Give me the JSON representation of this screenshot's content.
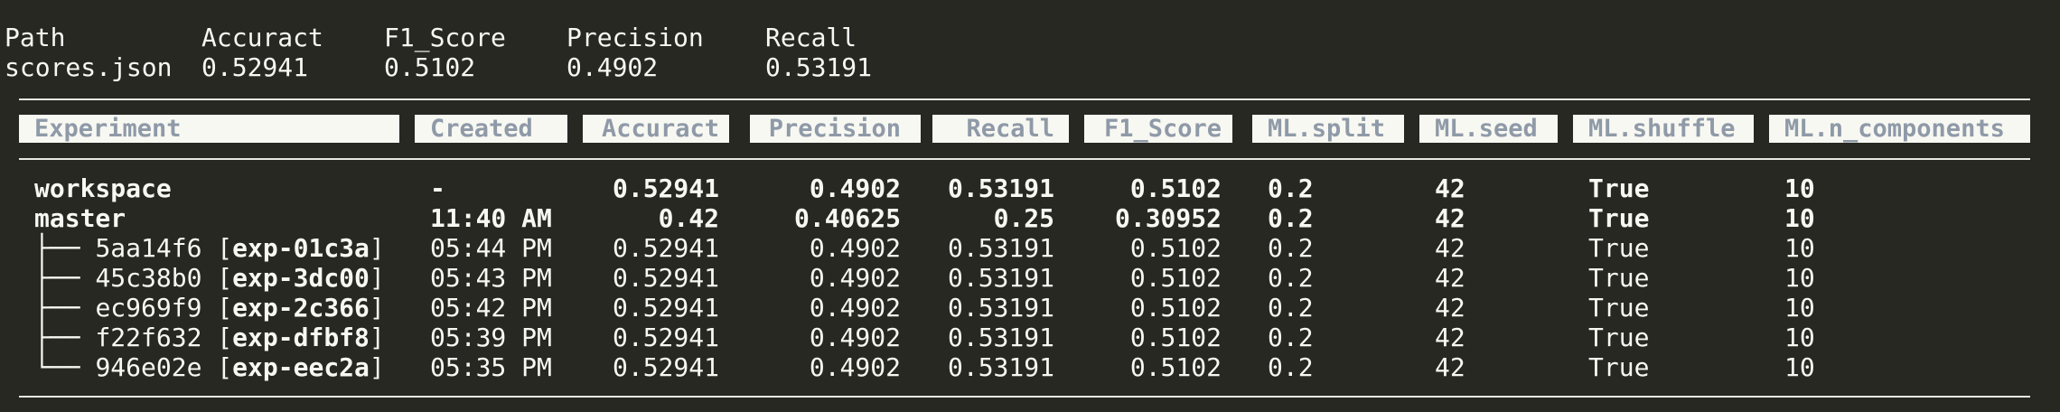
{
  "scores": {
    "headers": [
      "Path",
      "Accuract",
      "F1_Score",
      "Precision",
      "Recall"
    ],
    "values": [
      "scores.json",
      "0.52941",
      "0.5102",
      "0.4902",
      "0.53191"
    ]
  },
  "table": {
    "headers": [
      "Experiment",
      "Created",
      "Accuract",
      "Precision",
      "Recall",
      "F1_Score",
      "ML.split",
      "ML.seed",
      "ML.shuffle",
      "ML.n_components"
    ],
    "rows": [
      {
        "experiment": "workspace",
        "created": "-",
        "accuract": "0.52941",
        "precision": "0.4902",
        "recall": "0.53191",
        "f1_score": "0.5102",
        "split": "0.2",
        "seed": "42",
        "shuffle": "True",
        "n_components": "10"
      },
      {
        "experiment": "master",
        "created": "11:40 AM",
        "accuract": "0.42",
        "precision": "0.40625",
        "recall": "0.25",
        "f1_score": "0.30952",
        "split": "0.2",
        "seed": "42",
        "shuffle": "True",
        "n_components": "10"
      },
      {
        "tree": "├── ",
        "commit": "5aa14f6",
        "name": "exp-01c3a",
        "created": "05:44 PM",
        "accuract": "0.52941",
        "precision": "0.4902",
        "recall": "0.53191",
        "f1_score": "0.5102",
        "split": "0.2",
        "seed": "42",
        "shuffle": "True",
        "n_components": "10"
      },
      {
        "tree": "├── ",
        "commit": "45c38b0",
        "name": "exp-3dc00",
        "created": "05:43 PM",
        "accuract": "0.52941",
        "precision": "0.4902",
        "recall": "0.53191",
        "f1_score": "0.5102",
        "split": "0.2",
        "seed": "42",
        "shuffle": "True",
        "n_components": "10"
      },
      {
        "tree": "├── ",
        "commit": "ec969f9",
        "name": "exp-2c366",
        "created": "05:42 PM",
        "accuract": "0.52941",
        "precision": "0.4902",
        "recall": "0.53191",
        "f1_score": "0.5102",
        "split": "0.2",
        "seed": "42",
        "shuffle": "True",
        "n_components": "10"
      },
      {
        "tree": "├── ",
        "commit": "f22f632",
        "name": "exp-dfbf8",
        "created": "05:39 PM",
        "accuract": "0.52941",
        "precision": "0.4902",
        "recall": "0.53191",
        "f1_score": "0.5102",
        "split": "0.2",
        "seed": "42",
        "shuffle": "True",
        "n_components": "10"
      },
      {
        "tree": "└── ",
        "commit": "946e02e",
        "name": "exp-eec2a",
        "created": "05:35 PM",
        "accuract": "0.52941",
        "precision": "0.4902",
        "recall": "0.53191",
        "f1_score": "0.5102",
        "split": "0.2",
        "seed": "42",
        "shuffle": "True",
        "n_components": "10"
      }
    ]
  },
  "colors": {
    "background": "#272822",
    "text": "#f8f8f2",
    "header_box": "#f8f8f2",
    "header_text": "#8f9aa8"
  }
}
